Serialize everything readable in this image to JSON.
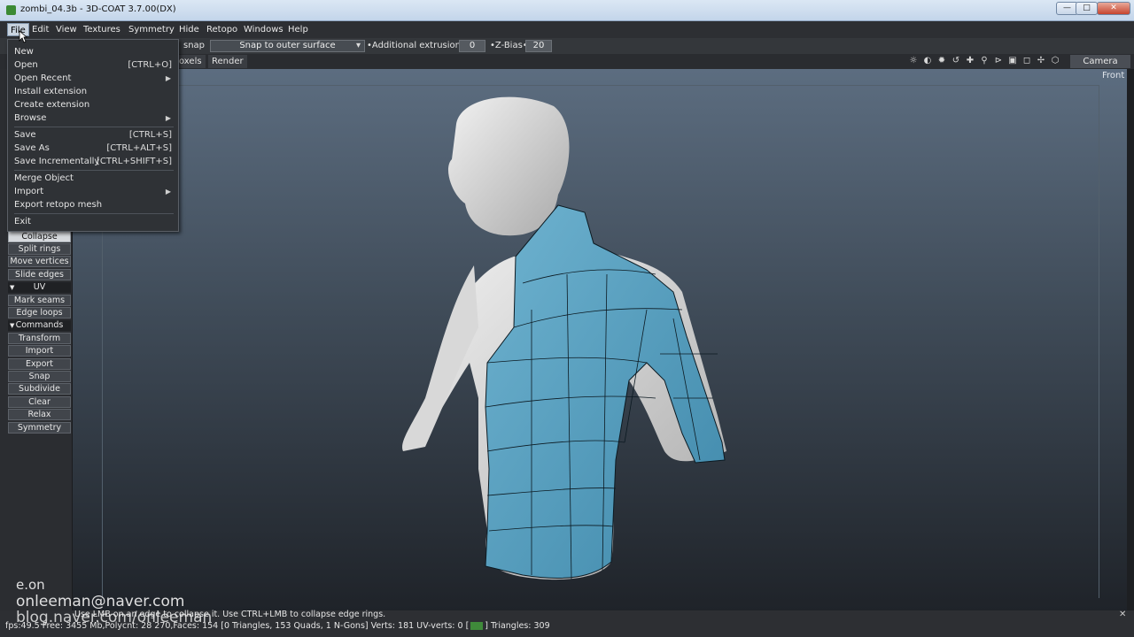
{
  "window": {
    "title": "zombi_04.3b - 3D-COAT 3.7.00(DX)",
    "min": "—",
    "max": "□",
    "close": "✕"
  },
  "menubar": [
    "File",
    "Edit",
    "View",
    "Textures",
    "Symmetry",
    "Hide",
    "Retopo",
    "Windows",
    "Help"
  ],
  "toolbar": {
    "snap_label": "snap",
    "snap_mode": "Snap to outer surface",
    "extrusion_label": "•Additional extrusion•",
    "extrusion_value": "0",
    "zbias_label": "•Z-Bias•",
    "zbias_value": "20"
  },
  "tabs": [
    "oxels",
    "Render"
  ],
  "viewport": {
    "camera": "Camera",
    "view_label": "Front"
  },
  "file_menu": {
    "new": "New",
    "open": "Open",
    "open_sc": "[CTRL+O]",
    "open_recent": "Open Recent",
    "install_extension": "Install extension",
    "create_extension": "Create extension",
    "browse": "Browse",
    "save": "Save",
    "save_sc": "[CTRL+S]",
    "save_as": "Save As",
    "save_as_sc": "[CTRL+ALT+S]",
    "save_inc": "Save Incrementally",
    "save_inc_sc": "[CTRL+SHIFT+S]",
    "merge_object": "Merge Object",
    "import": "Import",
    "export_retopo": "Export retopo mesh",
    "exit": "Exit"
  },
  "left_panel": {
    "collapse": "Collapse",
    "split_rings": "Split rings",
    "move_vertices": "Move vertices",
    "slide_edges": "Slide edges",
    "uv_section": "UV",
    "mark_seams": "Mark seams",
    "edge_loops": "Edge loops",
    "commands_section": "Commands",
    "transform": "Transform",
    "import": "Import",
    "export": "Export",
    "snap": "Snap",
    "subdivide": "Subdivide",
    "clear": "Clear",
    "relax": "Relax",
    "symmetry": "Symmetry"
  },
  "status": {
    "hint": "Use LMB on an edge to collapse it. Use CTRL+LMB to collapse edge rings.",
    "stats_a": "fps:49.5   Free: 3455 Mb,Polycnt: 28 270,Faces: 154 [0 Triangles, 153 Quads, 1 N-Gons] Verts: 181  UV-verts: 0 [",
    "stats_b": "] Triangles: 309"
  },
  "watermark": {
    "line1": "e.on",
    "line2": "onleeman@naver.com",
    "line3": "blog.naver.com/onleeman"
  }
}
